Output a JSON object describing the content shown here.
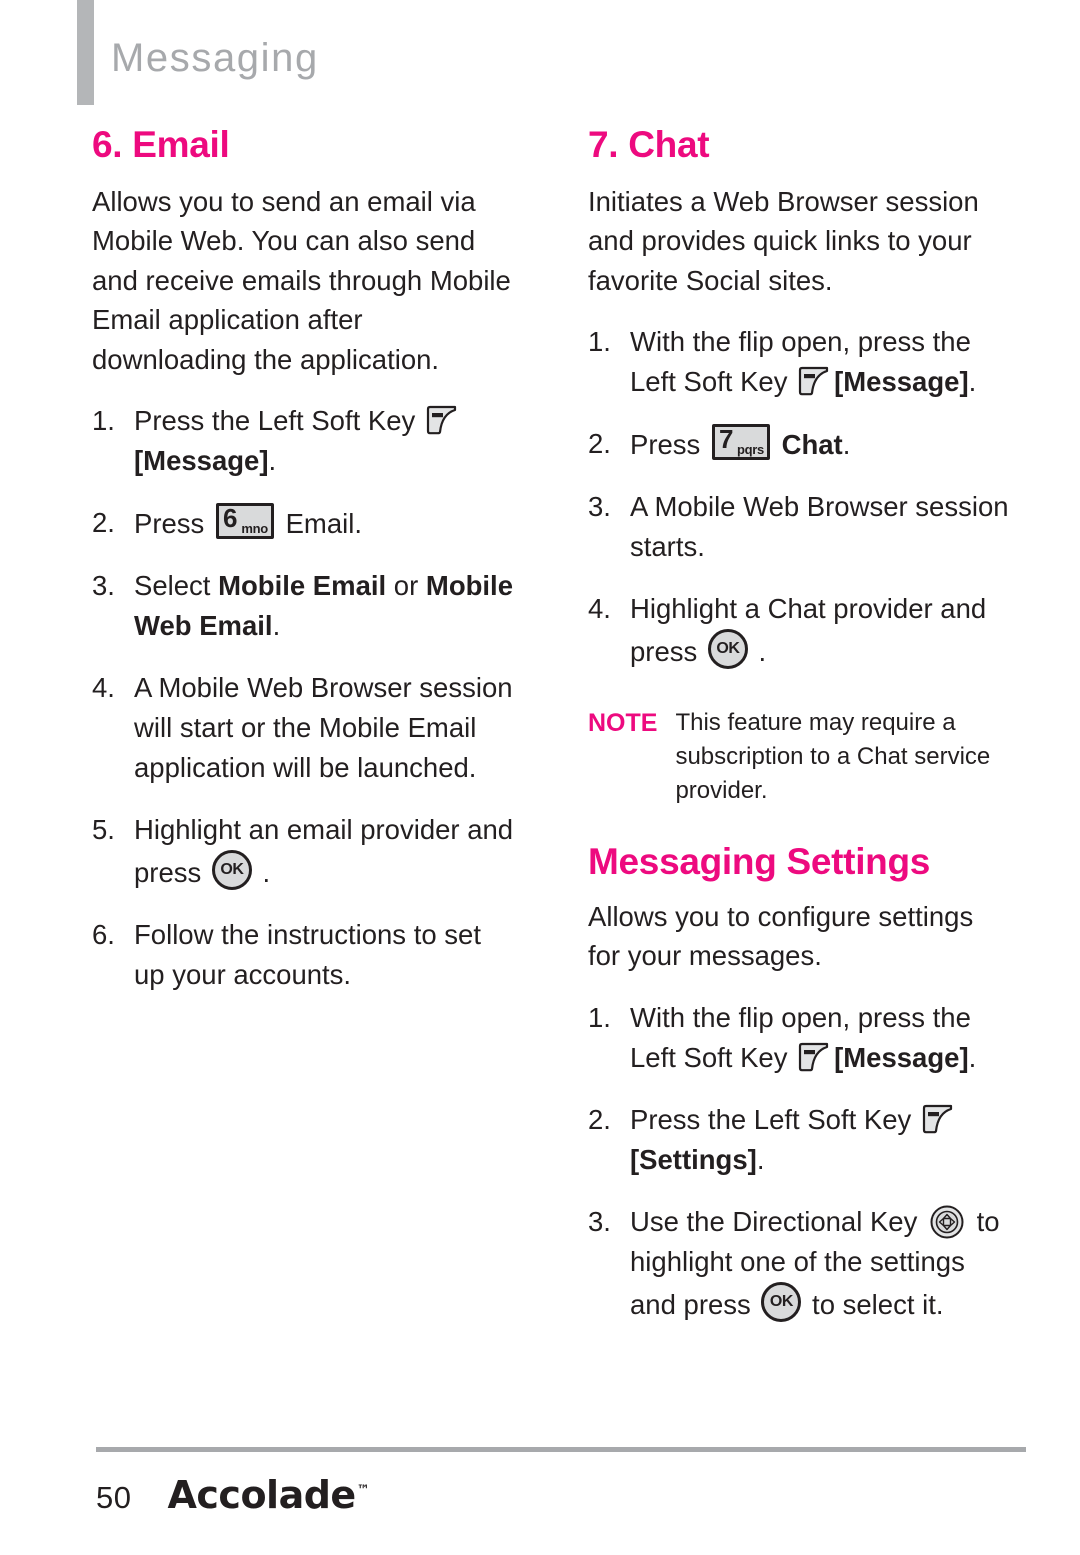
{
  "header": {
    "title": "Messaging"
  },
  "left_column": {
    "section": {
      "title": "6. Email",
      "intro": "Allows you to send an email via Mobile Web. You can also send and receive emails through Mobile Email application after downloading the application.",
      "steps": [
        {
          "num": "1.",
          "text_before": "Press the Left Soft Key ",
          "icon": "left-soft-key-icon",
          "text_after": " [Message].",
          "bold_after": "[Message]",
          "trailing": "."
        },
        {
          "num": "2.",
          "text_before": "Press ",
          "icon": "number-key-6-icon",
          "key_digit": "6",
          "key_letters": "mno",
          "text_after": " Email."
        },
        {
          "num": "3.",
          "text_before": "Select ",
          "bold_1": "Mobile Email",
          "mid": " or ",
          "bold_2": "Mobile Web Email",
          "trailing": "."
        },
        {
          "num": "4.",
          "text_before": "A Mobile Web Browser session will start or the Mobile Email application will be launched."
        },
        {
          "num": "5.",
          "text_before": "Highlight an email provider and press ",
          "icon": "ok-key-icon",
          "key_label": "OK",
          "text_after": " ."
        },
        {
          "num": "6.",
          "text_before": "Follow the instructions to set up your accounts."
        }
      ]
    }
  },
  "right_column": {
    "chat": {
      "title": "7. Chat",
      "intro": "Initiates a Web Browser session and provides quick links to your favorite Social sites.",
      "steps": [
        {
          "num": "1.",
          "text_before": "With the flip open, press the Left Soft Key ",
          "icon": "left-soft-key-icon",
          "bold_after": "[Message]",
          "trailing": "."
        },
        {
          "num": "2.",
          "text_before": "Press ",
          "icon": "number-key-7-icon",
          "key_digit": "7",
          "key_letters": "pqrs",
          "bold_after": "Chat",
          "trailing": "."
        },
        {
          "num": "3.",
          "text_before": "A Mobile Web Browser session starts."
        },
        {
          "num": "4.",
          "text_before": "Highlight a Chat provider and press ",
          "icon": "ok-key-icon",
          "key_label": "OK",
          "text_after": " ."
        }
      ],
      "note": {
        "label": "NOTE",
        "text": "This feature may require a subscription to a Chat service provider."
      }
    },
    "messaging_settings": {
      "title": "Messaging Settings",
      "intro": "Allows you to configure settings for your messages.",
      "steps": [
        {
          "num": "1.",
          "text_before": "With the flip open, press the Left Soft Key ",
          "icon": "left-soft-key-icon",
          "bold_after": "[Message]",
          "trailing": "."
        },
        {
          "num": "2.",
          "text_before": "Press the Left Soft Key ",
          "icon": "left-soft-key-icon",
          "bold_after": "[Settings]",
          "trailing": "."
        },
        {
          "num": "3.",
          "text_before": "Use the Directional Key ",
          "icon": "directional-key-icon",
          "mid": " to highlight one of the settings and press ",
          "icon2": "ok-key-icon",
          "key_label": "OK",
          "text_after": " to select it."
        }
      ]
    }
  },
  "footer": {
    "page_number": "50",
    "brand": "Accolade",
    "trademark": "™"
  },
  "colors": {
    "accent_pink": "#ed0a7f",
    "header_gray": "#a7a9ac",
    "rule_gray": "#b4b6b8",
    "body_text": "#231f20",
    "key_fill": "#d9dadb"
  }
}
